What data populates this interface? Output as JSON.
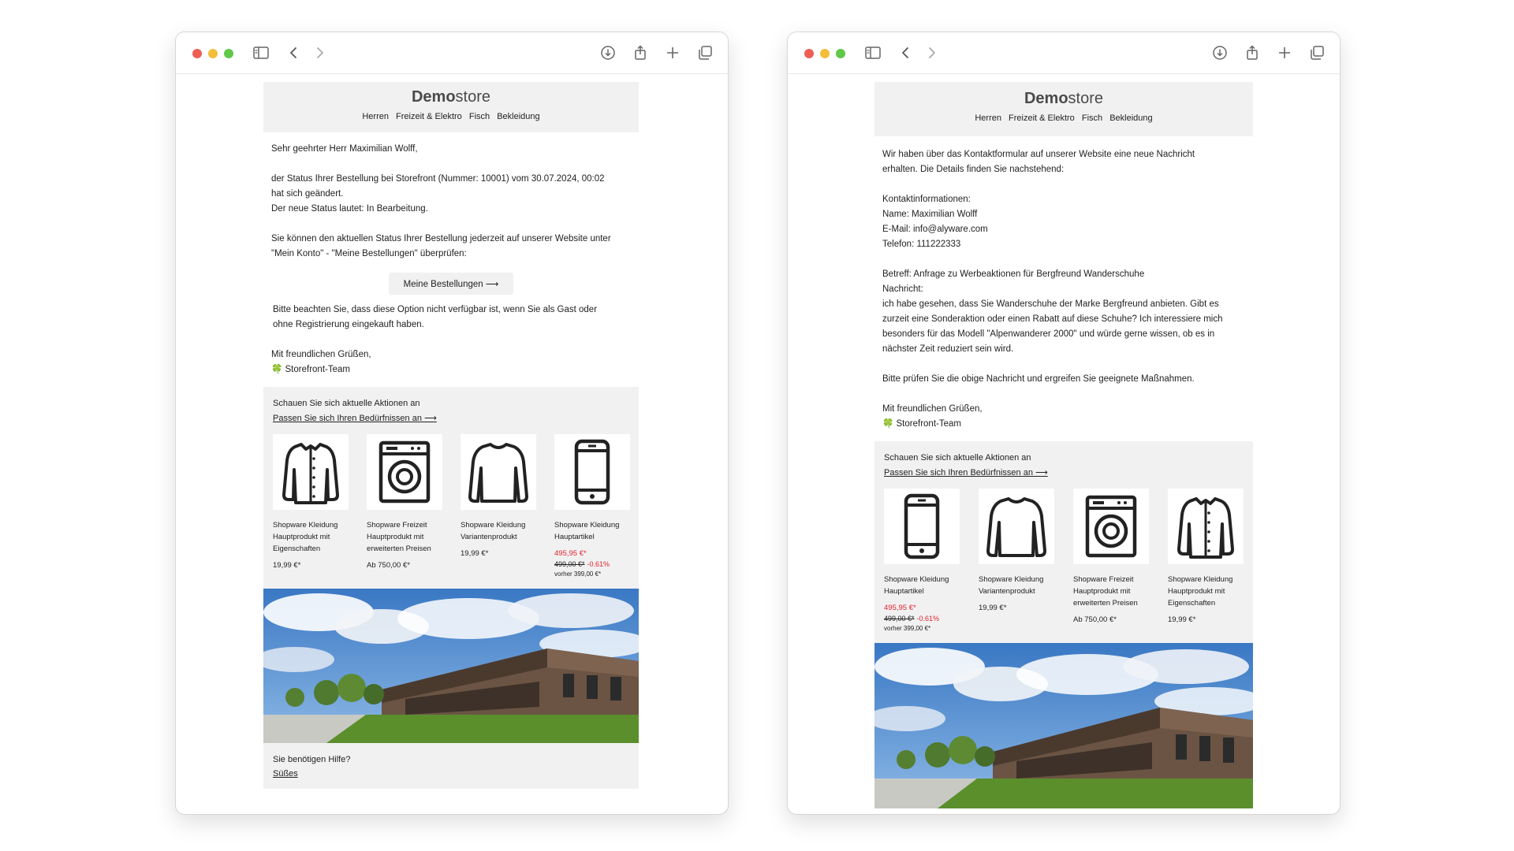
{
  "browser": {
    "icons": [
      "sidebar-icon",
      "back-icon",
      "forward-icon",
      "download-icon",
      "share-icon",
      "new-tab-icon",
      "tabs-overview-icon"
    ]
  },
  "left": {
    "logo": {
      "part1": "Demo",
      "part2": "store"
    },
    "nav": [
      "Herren",
      "Freizeit & Elektro",
      "Fisch",
      "Bekleidung"
    ],
    "greeting": "Sehr geehrter Herr Maximilian Wolff,",
    "status_line1": "der Status Ihrer Bestellung bei Storefront (Nummer: 10001) vom 30.07.2024, 00:02",
    "status_line2": "hat sich geändert.",
    "status_line3": "Der neue Status lautet: In Bearbeitung.",
    "check_line1": "Sie können den aktuellen Status Ihrer Bestellung jederzeit auf unserer Website unter",
    "check_line2": "\"Mein Konto\" - \"Meine Bestellungen\" überprüfen:",
    "button": "Meine Bestellungen ⟶",
    "note_line1": "Bitte beachten Sie, dass diese Option nicht verfügbar ist, wenn Sie als Gast oder",
    "note_line2": "ohne Registrierung eingekauft haben.",
    "closing": "Mit freundlichen Grüßen,",
    "team": "🍀 Storefront-Team",
    "promo": {
      "title": "Schauen Sie sich aktuelle Aktionen an",
      "link": "Passen Sie sich Ihren Bedürfnissen an ⟶",
      "products": [
        {
          "icon": "jacket-icon",
          "name": "Shopware Kleidung Hauptprodukt mit Eigenschaften",
          "price": "19,99 €*"
        },
        {
          "icon": "washing-machine-icon",
          "name": "Shopware Freizeit Hauptprodukt mit erweiterten Preisen",
          "price": "Ab 750,00 €*"
        },
        {
          "icon": "sweater-icon",
          "name": "Shopware Kleidung Variantenprodukt",
          "price": "19,99 €*"
        },
        {
          "icon": "smartphone-icon",
          "name": "Shopware Kleidung Hauptartikel",
          "price": "495,95 €*",
          "old_price": "499,00 €*",
          "discount": "-0.61%",
          "before": "vorher 399,00 €*"
        }
      ]
    },
    "help": {
      "question": "Sie benötigen Hilfe?",
      "link": "Süßes"
    }
  },
  "right": {
    "logo": {
      "part1": "Demo",
      "part2": "store"
    },
    "nav": [
      "Herren",
      "Freizeit & Elektro",
      "Fisch",
      "Bekleidung"
    ],
    "intro_line1": "Wir haben über das Kontaktformular auf unserer Website eine neue Nachricht",
    "intro_line2": "erhalten. Die Details finden Sie nachstehend:",
    "contact_title": "Kontaktinformationen:",
    "name": "Name: Maximilian Wolff",
    "email": "E-Mail: info@alyware.com",
    "phone": "Telefon: 111222333",
    "subject": "Betreff: Anfrage zu Werbeaktionen für Bergfreund Wanderschuhe",
    "message_label": "Nachricht:",
    "message_line1": "ich habe gesehen, dass Sie Wanderschuhe der Marke Bergfreund anbieten. Gibt es",
    "message_line2": "zurzeit eine Sonderaktion oder einen Rabatt auf diese Schuhe? Ich interessiere mich",
    "message_line3": "besonders für das Modell \"Alpenwanderer 2000\" und würde gerne wissen, ob es in",
    "message_line4": "nächster Zeit reduziert sein wird.",
    "check": "Bitte prüfen Sie die obige Nachricht und ergreifen Sie geeignete Maßnahmen.",
    "closing": "Mit freundlichen Grüßen,",
    "team": "🍀 Storefront-Team",
    "promo": {
      "title": "Schauen Sie sich aktuelle Aktionen an",
      "link": "Passen Sie sich Ihren Bedürfnissen an ⟶",
      "products": [
        {
          "icon": "smartphone-icon",
          "name": "Shopware Kleidung Hauptartikel",
          "price": "495,95 €*",
          "old_price": "499,00 €*",
          "discount": "-0.61%",
          "before": "vorher 399,00 €*"
        },
        {
          "icon": "sweater-icon",
          "name": "Shopware Kleidung Variantenprodukt",
          "price": "19,99 €*"
        },
        {
          "icon": "washing-machine-icon",
          "name": "Shopware Freizeit Hauptprodukt mit erweiterten Preisen",
          "price": "Ab 750,00 €*"
        },
        {
          "icon": "jacket-icon",
          "name": "Shopware Kleidung Hauptprodukt mit Eigenschaften",
          "price": "19,99 €*"
        }
      ]
    }
  },
  "colors": {
    "panel": "#f1f1f2",
    "sale": "#e0242b",
    "text": "#222222"
  }
}
